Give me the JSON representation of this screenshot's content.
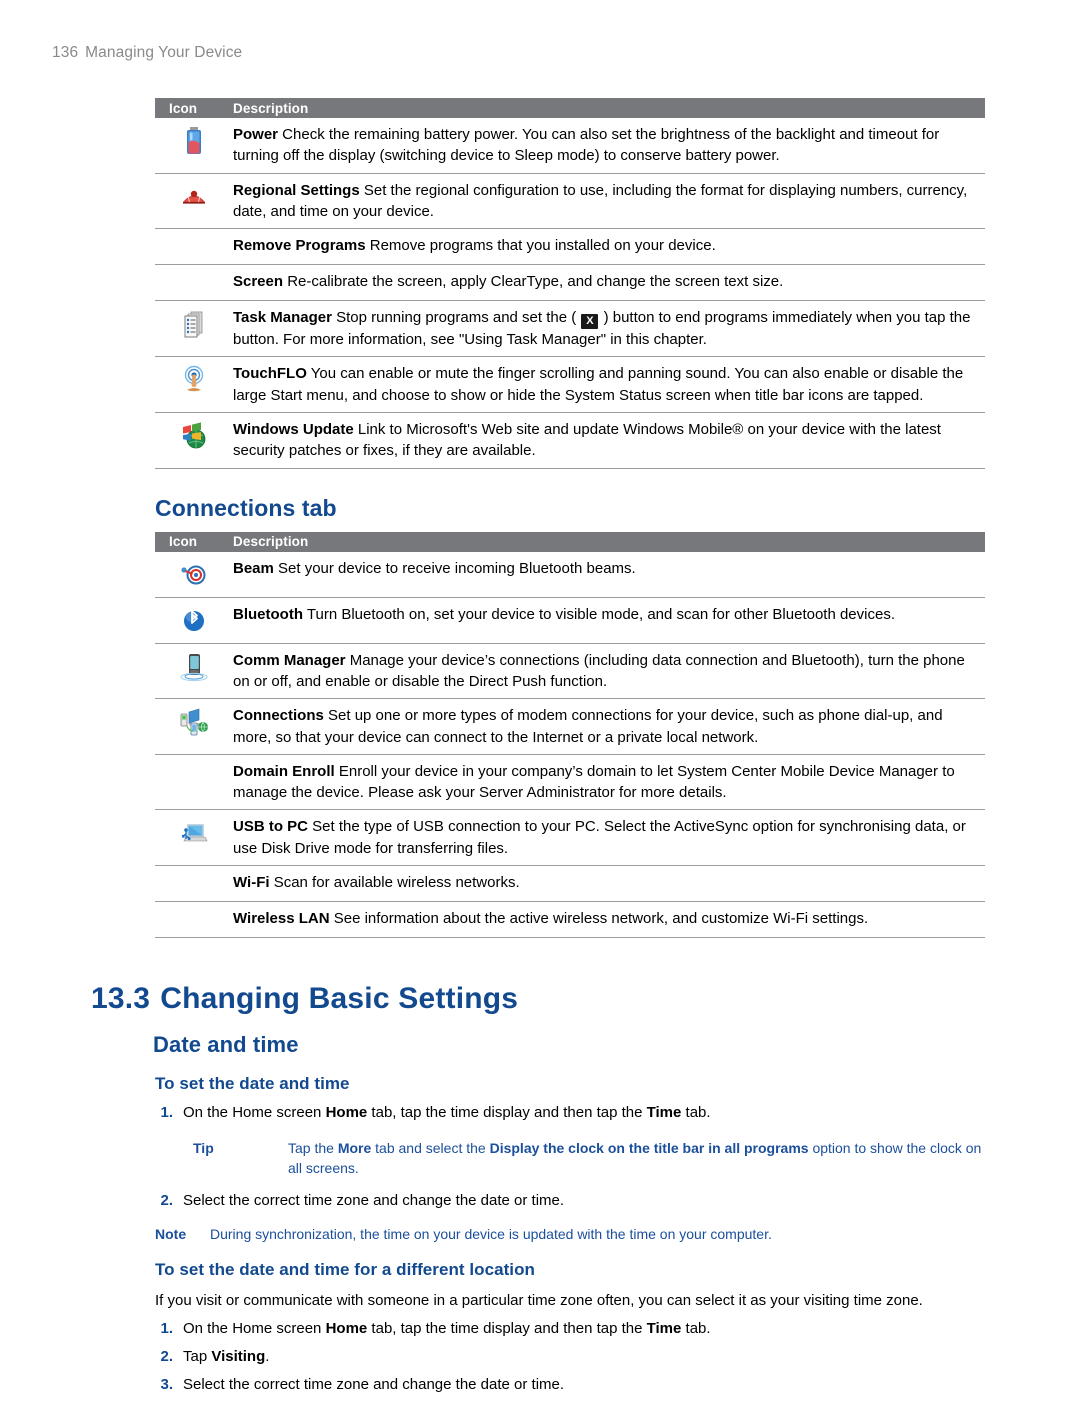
{
  "header": {
    "page_number": "136",
    "title": "Managing Your Device"
  },
  "colors": {
    "heading_blue": "#12498f",
    "callout_blue": "#1b4f9c",
    "table_header_gray": "#77787b",
    "header_text_gray": "#8a8a8a"
  },
  "table_system": {
    "columns": {
      "icon": "Icon",
      "description": "Description"
    },
    "rows": [
      {
        "icon": "battery-icon",
        "term": "Power",
        "text": " Check the remaining battery power. You can also set the brightness of the backlight and timeout for turning off the display (switching device to Sleep mode) to conserve battery power."
      },
      {
        "icon": "regional-settings-icon",
        "term": "Regional Settings",
        "text": " Set the regional configuration to use, including the format for displaying numbers, currency, date, and time on your device."
      },
      {
        "icon": "none",
        "term": "Remove Programs",
        "text": " Remove programs that you installed on your device."
      },
      {
        "icon": "none",
        "term": "Screen",
        "text": " Re-calibrate the screen, apply ClearType, and change the screen text size."
      },
      {
        "icon": "task-manager-icon",
        "term": "Task Manager",
        "text_before": " Stop running programs and set the ( ",
        "chip": "X",
        "text_after": " ) button to end programs immediately when you tap the button. For more information, see \"Using Task Manager\" in this chapter."
      },
      {
        "icon": "touchflo-icon",
        "term": "TouchFLO",
        "text": " You can enable or mute the finger scrolling and panning sound. You can also enable or disable the large Start menu, and choose to show or hide the System Status screen when title bar icons are tapped."
      },
      {
        "icon": "windows-update-icon",
        "term": "Windows Update",
        "text": " Link to Microsoft's Web site and update Windows Mobile® on your device with the latest security patches or fixes, if they are available."
      }
    ]
  },
  "connections_section": {
    "heading": "Connections tab",
    "columns": {
      "icon": "Icon",
      "description": "Description"
    },
    "rows": [
      {
        "icon": "beam-icon",
        "term": "Beam",
        "text": " Set your device to receive incoming Bluetooth beams."
      },
      {
        "icon": "bluetooth-icon",
        "term": "Bluetooth",
        "text": " Turn Bluetooth on, set your device to visible mode, and scan for other Bluetooth devices."
      },
      {
        "icon": "comm-manager-icon",
        "term": "Comm Manager",
        "text": " Manage your device’s connections (including data connection and Bluetooth), turn the phone on or off, and enable or disable the Direct Push function."
      },
      {
        "icon": "connections-icon",
        "term": "Connections",
        "text": " Set up one or more types of modem connections for your device, such as phone dial-up, and more, so that your device can connect to the Internet or a private local network."
      },
      {
        "icon": "none",
        "term": "Domain Enroll",
        "text": " Enroll your device in your company’s domain to let System Center Mobile Device Manager to manage the device. Please ask your Server Administrator for more details."
      },
      {
        "icon": "usb-to-pc-icon",
        "term": "USB to PC",
        "text": " Set the type of USB connection to your PC. Select the ActiveSync option for synchronising data, or use Disk Drive mode for transferring files."
      },
      {
        "icon": "none",
        "term": "Wi-Fi",
        "text": " Scan for available wireless networks."
      },
      {
        "icon": "none",
        "term": "Wireless LAN",
        "text": " See information about the active wireless network, and customize Wi-Fi settings."
      }
    ]
  },
  "chapter": {
    "number": "13.3",
    "title": "Changing Basic Settings",
    "subsection": "Date and time"
  },
  "procedure_1": {
    "heading": "To set the date and time",
    "steps": [
      {
        "num": "1.",
        "text_1": "On the Home screen ",
        "bold_1": "Home",
        "text_2": " tab, tap the time display and then tap the ",
        "bold_2": "Time",
        "text_3": " tab."
      },
      {
        "num": "2.",
        "text_1": "Select the correct time zone and change the date or time.",
        "bold_1": "",
        "text_2": "",
        "bold_2": "",
        "text_3": ""
      }
    ],
    "tip": {
      "label": "Tip",
      "text_1": "Tap the ",
      "bold_1": "More",
      "text_2": " tab and select the ",
      "bold_2": "Display the clock on the title bar in all programs",
      "text_3": " option to show the clock on all screens."
    },
    "note": {
      "label": "Note",
      "text": "During synchronization, the time on your device is updated with the time on your computer."
    }
  },
  "procedure_2": {
    "heading": "To set the date and time for a different location",
    "intro": "If you visit or communicate with someone in a particular time zone often, you can select it as your visiting time zone.",
    "steps": [
      {
        "num": "1.",
        "text_1": "On the Home screen ",
        "bold_1": "Home",
        "text_2": " tab, tap the time display and then tap the ",
        "bold_2": "Time",
        "text_3": " tab."
      },
      {
        "num": "2.",
        "text_1": "Tap ",
        "bold_1": "Visiting",
        "text_2": ".",
        "bold_2": "",
        "text_3": ""
      },
      {
        "num": "3.",
        "text_1": "Select the correct time zone and change the date or time.",
        "bold_1": "",
        "text_2": "",
        "bold_2": "",
        "text_3": ""
      }
    ]
  }
}
